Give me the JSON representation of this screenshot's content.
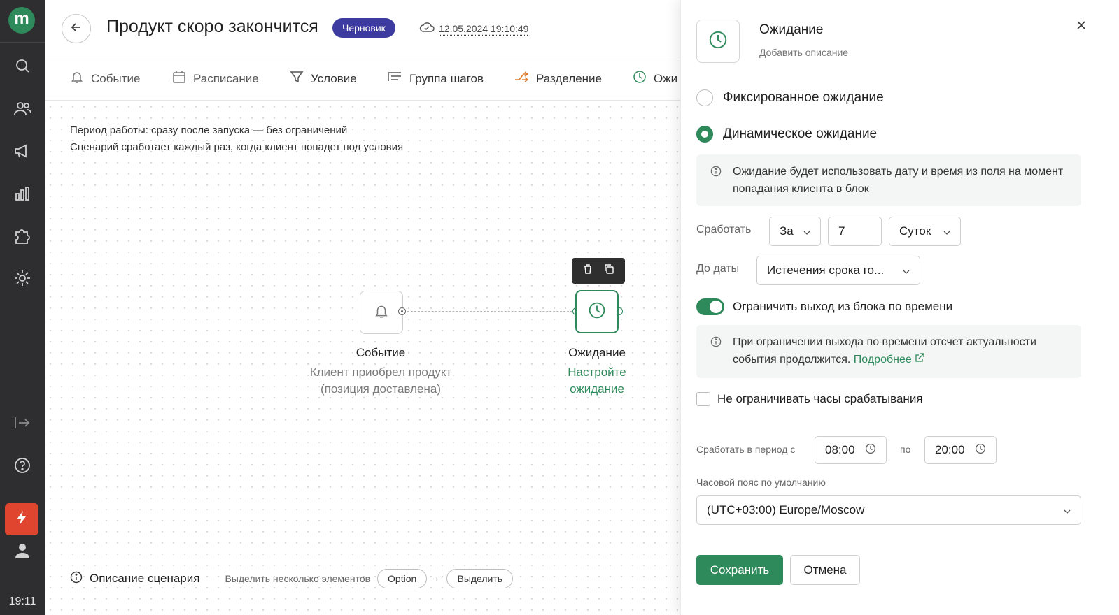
{
  "sidebar": {
    "logo": "m",
    "icons": [
      "search-icon",
      "users-icon",
      "megaphone-icon",
      "analytics-icon",
      "puzzle-icon",
      "gear-icon",
      "collapse-icon",
      "help-icon",
      "flash-icon",
      "user-icon"
    ],
    "time": "19:11"
  },
  "header": {
    "title": "Продукт скоро закончится",
    "status_badge": "Черновик",
    "saved_at": "12.05.2024 19:10:49"
  },
  "toolbar": {
    "items": [
      {
        "label": "Событие",
        "icon": "bell-icon"
      },
      {
        "label": "Расписание",
        "icon": "calendar-icon"
      },
      {
        "label": "Условие",
        "icon": "filter-icon"
      },
      {
        "label": "Группа шагов",
        "icon": "group-icon"
      },
      {
        "label": "Разделение",
        "icon": "split-icon"
      },
      {
        "label": "Ожи",
        "icon": "clock-icon"
      }
    ]
  },
  "canvas": {
    "period_line1": "Период работы: сразу после запуска — без ограничений",
    "period_line2": "Сценарий сработает каждый раз, когда клиент попадет под условия",
    "event_node": {
      "title": "Событие",
      "subtitle_line1": "Клиент приобрел продукт",
      "subtitle_line2": "(позиция доставлена)"
    },
    "wait_node": {
      "title": "Ожидание",
      "subtitle_line1": "Настройте",
      "subtitle_line2": "ожидание"
    },
    "footer": {
      "description": "Описание сценария",
      "hint": "Выделить несколько элементов",
      "key1": "Option",
      "plus": "+",
      "key2": "Выделить"
    }
  },
  "panel": {
    "title": "Ожидание",
    "add_description": "Добавить описание",
    "radio_fixed": "Фиксированное ожидание",
    "radio_dynamic": "Динамическое ожидание",
    "info_dynamic": "Ожидание будет использовать дату и время из поля на момент попадания клиента в блок",
    "trigger_label": "Сработать",
    "trigger_when": "За",
    "trigger_amount": "7",
    "trigger_unit": "Суток",
    "until_label": "До даты",
    "until_value": "Истечения срока го...",
    "toggle_label": "Ограничить выход из блока по времени",
    "toggle_on": true,
    "info_limit": "При ограничении выхода по времени отсчет актуальности события продолжится.",
    "info_link": "Подробнее",
    "checkbox_label": "Не ограничивать часы срабатывания",
    "period_label": "Сработать в период с",
    "period_from": "08:00",
    "period_to_label": "по",
    "period_to": "20:00",
    "timezone_label": "Часовой пояс по умолчанию",
    "timezone_value": "(UTC+03:00) Europe/Moscow",
    "save": "Сохранить",
    "cancel": "Отмена"
  },
  "colors": {
    "accent": "#2f8a5b",
    "badge": "#3d3aa0",
    "rail": "#2e2e30",
    "flash": "#e0452f"
  }
}
